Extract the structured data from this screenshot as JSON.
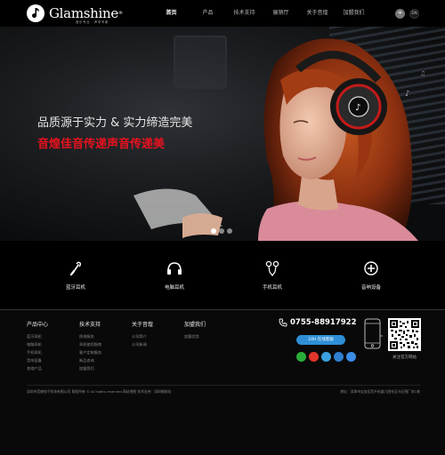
{
  "header": {
    "logo_text": "Glamshine",
    "logo_reg": "®",
    "logo_slogan": "音乐专业 · 声学专家",
    "nav": [
      "首页",
      "产品",
      "技术支持",
      "展销厅",
      "关于音煌",
      "加盟我们"
    ],
    "lang_cn": "中",
    "lang_en": "EN"
  },
  "banner": {
    "slogan_line1": "品质源于实力 & 实力缔造完美",
    "slogan_line2": "音煌佳音传递声音传递美",
    "slides": 3,
    "active_slide": 1
  },
  "categories": [
    {
      "label": "蓝牙耳机",
      "icon": "bluetooth-headphone-icon"
    },
    {
      "label": "电脑耳机",
      "icon": "headphone-icon"
    },
    {
      "label": "手机耳机",
      "icon": "earphone-icon"
    },
    {
      "label": "音响设备",
      "icon": "plus-icon"
    }
  ],
  "footer": {
    "columns": [
      {
        "title": "产品中心",
        "links": [
          "蓝牙耳机",
          "电脑耳机",
          "手机耳机",
          "音响设备",
          "其他产品"
        ]
      },
      {
        "title": "技术支持",
        "links": [
          "保修服务",
          "耳机使用指南",
          "客户定制服务",
          "新品咨询",
          "加盟我们"
        ]
      },
      {
        "title": "关于音煌",
        "links": [
          "公司简介",
          "公司新闻"
        ]
      },
      {
        "title": "加盟我们",
        "links": [
          "加盟优势"
        ]
      }
    ],
    "phone": "0755-88917922",
    "service_button": "24H 在线客服",
    "social_colors": [
      "#2aae3a",
      "#e0362c",
      "#3aa0e0",
      "#2e7fd0",
      "#3a8de6"
    ],
    "qr_caption": "关注官方网站",
    "copyright": "深圳市音煌电子科技有限公司 版权所有 © All rights reserved 网站地图 技术支持：深圳做网站",
    "address": "地址：深圳市宝安区西乡街道九围社区乌石围厂房1栋"
  },
  "colors": {
    "accent_red": "#e8121e",
    "service_blue": "#2f8fd6"
  }
}
